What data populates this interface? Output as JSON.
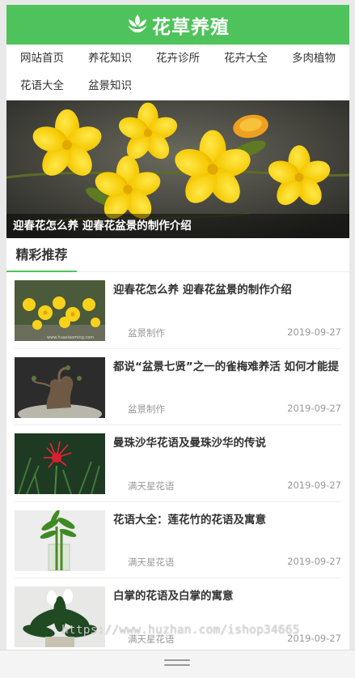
{
  "header": {
    "logo_icon": "lotus-flower-icon",
    "title": "花草养殖",
    "bg_color": "#4fc35b"
  },
  "nav": {
    "items": [
      {
        "label": "网站首页"
      },
      {
        "label": "养花知识"
      },
      {
        "label": "花卉诊所"
      },
      {
        "label": "花卉大全"
      },
      {
        "label": "多肉植物"
      },
      {
        "label": "花语大全"
      },
      {
        "label": "盆景知识"
      }
    ]
  },
  "banner": {
    "caption": "迎春花怎么养 迎春花盆景的制作介绍",
    "slide_count": 5,
    "active_slide": 0
  },
  "section": {
    "title": "精彩推荐",
    "accent_color": "#4fc35b"
  },
  "articles": [
    {
      "title": "迎春花怎么养 迎春花盆景的制作介绍",
      "category": "盆景制作",
      "date": "2019-09-27",
      "thumb": "yellow-jasmine-photo"
    },
    {
      "title": "都说“盆景七贤”之一的雀梅难养活 如何才能提",
      "category": "盆景制作",
      "date": "2019-09-27",
      "thumb": "bonsai-tree-photo"
    },
    {
      "title": "曼珠沙华花语及曼珠沙华的传说",
      "category": "满天星花语",
      "date": "2019-09-27",
      "thumb": "red-spider-lily-photo"
    },
    {
      "title": "花语大全：莲花竹的花语及寓意",
      "category": "满天星花语",
      "date": "2019-09-27",
      "thumb": "lucky-bamboo-photo"
    },
    {
      "title": "白掌的花语及白掌的寓意",
      "category": "满天星花语",
      "date": "2019-09-27",
      "thumb": "peace-lily-photo"
    }
  ],
  "watermark": "https://www.huzhan.com/ishop34665"
}
